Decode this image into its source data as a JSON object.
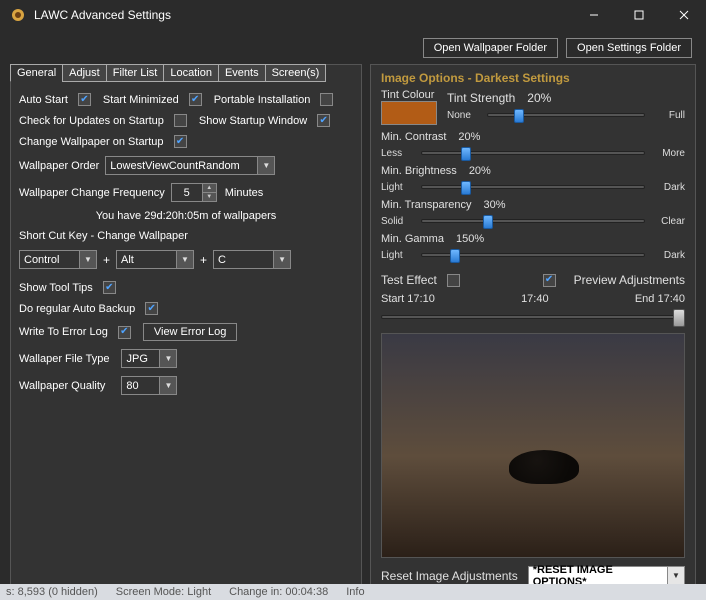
{
  "titlebar": {
    "title": "LAWC Advanced Settings"
  },
  "topbar": {
    "open_wallpaper_folder": "Open Wallpaper Folder",
    "open_settings_folder": "Open Settings Folder"
  },
  "tabs": [
    "General",
    "Adjust",
    "Filter List",
    "Location",
    "Events",
    "Screen(s)"
  ],
  "general": {
    "auto_start": {
      "label": "Auto Start",
      "checked": true
    },
    "start_minimized": {
      "label": "Start Minimized",
      "checked": true
    },
    "portable_installation": {
      "label": "Portable Installation",
      "checked": false
    },
    "check_updates": {
      "label": "Check for Updates on Startup",
      "checked": false
    },
    "show_startup": {
      "label": "Show Startup Window",
      "checked": true
    },
    "change_wp_startup": {
      "label": "Change Wallpaper on Startup",
      "checked": true
    },
    "wallpaper_order": {
      "label": "Wallpaper Order",
      "value": "LowestViewCountRandom"
    },
    "change_freq": {
      "label": "Wallpaper Change Frequency",
      "value": "5",
      "unit": "Minutes"
    },
    "duration_text": "You have 29d:20h:05m of wallpapers",
    "shortcut": {
      "title": "Short Cut Key - Change Wallpaper",
      "mod1": "Control",
      "mod2": "Alt",
      "key": "C"
    },
    "show_tooltips": {
      "label": "Show Tool Tips",
      "checked": true
    },
    "auto_backup": {
      "label": "Do regular Auto Backup",
      "checked": true
    },
    "write_error_log": {
      "label": "Write To Error Log",
      "checked": true
    },
    "view_error_log": "View Error Log",
    "file_type": {
      "label": "Wallaper File Type",
      "value": "JPG"
    },
    "quality": {
      "label": "Wallpaper Quality",
      "value": "80"
    }
  },
  "image_options": {
    "title": "Image Options - Darkest Settings",
    "tint_colour_label": "Tint Colour",
    "tint_colour": "#B25C16",
    "tint_strength": {
      "label": "Tint Strength",
      "value": "20%",
      "min_label": "None",
      "max_label": "Full",
      "percent": 20
    },
    "contrast": {
      "label": "Min. Contrast",
      "value": "20%",
      "min_label": "Less",
      "max_label": "More",
      "percent": 20
    },
    "brightness": {
      "label": "Min. Brightness",
      "value": "20%",
      "min_label": "Light",
      "max_label": "Dark",
      "percent": 20
    },
    "transparency": {
      "label": "Min. Transparency",
      "value": "30%",
      "min_label": "Solid",
      "max_label": "Clear",
      "percent": 30
    },
    "gamma": {
      "label": "Min. Gamma",
      "value": "150%",
      "min_label": "Light",
      "max_label": "Dark",
      "percent": 15
    },
    "test_effect": {
      "label": "Test Effect",
      "checked": false
    },
    "preview_adjustments": {
      "label": "Preview Adjustments",
      "checked": true
    },
    "time": {
      "start": "Start 17:10",
      "mid": "17:40",
      "end": "End 17:40"
    },
    "reset_label": "Reset Image Adjustments",
    "reset_select": "*RESET IMAGE OPTIONS*"
  },
  "status": {
    "count": "s: 8,593 (0 hidden)",
    "screen_mode": "Screen Mode: Light",
    "change_in": "Change in: 00:04:38",
    "info": "Info"
  }
}
